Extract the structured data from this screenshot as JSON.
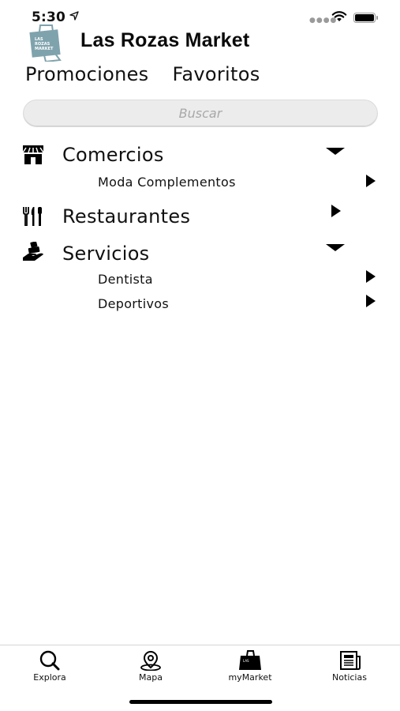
{
  "status_bar": {
    "time": "5:30"
  },
  "header": {
    "title": "Las Rozas Market",
    "logo_text": [
      "LAS",
      "ROZAS",
      "MARKET"
    ]
  },
  "top_tabs": [
    {
      "label": "Promociones"
    },
    {
      "label": "Favoritos"
    }
  ],
  "search": {
    "placeholder": "Buscar"
  },
  "categories": [
    {
      "label": "Comercios",
      "icon": "store-icon",
      "expanded": true,
      "items": [
        "Moda Complementos"
      ]
    },
    {
      "label": "Restaurantes",
      "icon": "utensils-icon",
      "expanded": false,
      "items": []
    },
    {
      "label": "Servicios",
      "icon": "service-hand-icon",
      "expanded": true,
      "items": [
        "Dentista",
        "Deportivos"
      ]
    }
  ],
  "tab_bar": [
    {
      "label": "Explora",
      "icon": "search-icon"
    },
    {
      "label": "Mapa",
      "icon": "map-pin-icon"
    },
    {
      "label": "myMarket",
      "icon": "shopping-bag-icon"
    },
    {
      "label": "Noticias",
      "icon": "newspaper-icon"
    }
  ],
  "colors": {
    "text": "#111111",
    "search_bg": "#ececec",
    "logo": "#7fa3ad"
  }
}
